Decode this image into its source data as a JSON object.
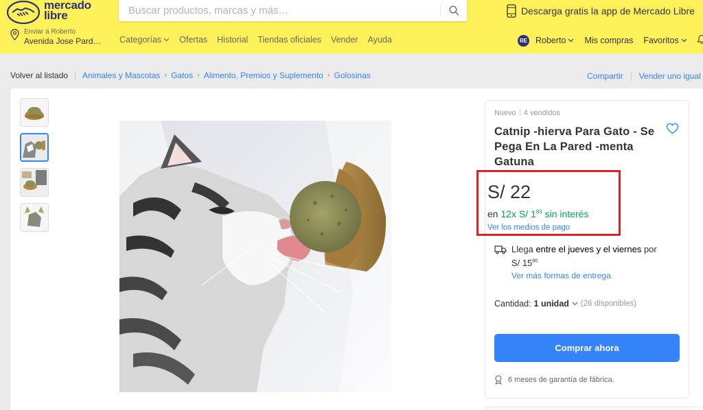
{
  "header": {
    "logo": {
      "line1": "mercado",
      "line2": "libre"
    },
    "search": {
      "placeholder": "Buscar productos, marcas y más…",
      "icon": "search-icon"
    },
    "app_promo": "Descarga gratis la app de Mercado Libre",
    "location": {
      "line1": "Enviar a Roberto",
      "line2": "Avenida Jose Pard…"
    },
    "nav": [
      {
        "label": "Categorías",
        "has_chevron": true
      },
      {
        "label": "Ofertas"
      },
      {
        "label": "Historial"
      },
      {
        "label": "Tiendas oficiales"
      },
      {
        "label": "Vender"
      },
      {
        "label": "Ayuda"
      }
    ],
    "user": {
      "initials": "RE",
      "name": "Roberto",
      "purchases": "Mis compras",
      "favorites": "Favoritos"
    }
  },
  "breadcrumb": {
    "back": "Volver al listado",
    "items": [
      "Animales y Mascotas",
      "Gatos",
      "Alimento, Premios y Suplemento",
      "Golosinas"
    ],
    "share": "Compartir",
    "sell_same": "Vender uno igual"
  },
  "product": {
    "condition": "Nuevo",
    "sold": "4 vendidos",
    "title": "Catnip -hierva Para Gato - Se Pega En La Pared -menta Gatuna",
    "price": "S/ 22",
    "installments": {
      "prefix": "en",
      "count": "12x",
      "amount": "S/ 1",
      "cents": "83",
      "suffix": "sin interés"
    },
    "payment_link": "Ver los medios de pago",
    "shipping": {
      "prefix": "Llega ",
      "highlight": "entre el jueves y el viernes",
      "suffix": " por",
      "price": "S/ 15",
      "price_cents": "90",
      "more_link": "Ver más formas de entrega"
    },
    "quantity": {
      "label": "Cantidad:",
      "value": "1 unidad",
      "available": "(26 disponibles)"
    },
    "buy_button": "Comprar ahora",
    "warranty": "6 meses de garantía de fábrica."
  },
  "colors": {
    "header_bg": "#fff159",
    "brand_blue": "#2d3277",
    "link_blue": "#3483fa",
    "green": "#00a650",
    "highlight_red": "#e0202e"
  }
}
